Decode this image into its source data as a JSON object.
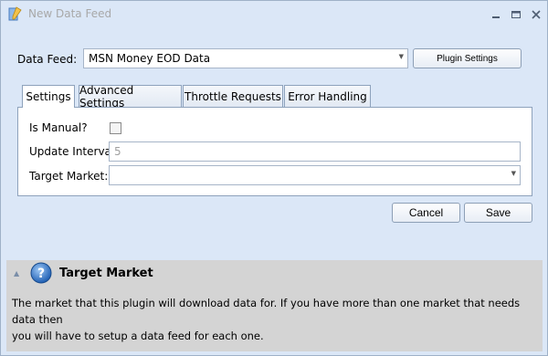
{
  "window": {
    "title": "New Data Feed",
    "icons": {
      "app": "app-feed-icon",
      "minimize": "minimize-icon",
      "maximize": "maximize-icon",
      "close": "close-icon"
    }
  },
  "form": {
    "data_feed_label": "Data Feed:",
    "data_feed_value": "MSN Money EOD Data",
    "plugin_settings_label": "Plugin Settings",
    "tabs": [
      {
        "label": "Settings",
        "active": true
      },
      {
        "label": "Advanced Settings",
        "active": false
      },
      {
        "label": "Throttle Requests",
        "active": false
      },
      {
        "label": "Error Handling",
        "active": false
      }
    ],
    "settings": {
      "is_manual_label": "Is Manual?",
      "is_manual_checked": false,
      "update_interval_label": "Update Interval:",
      "update_interval_value": "5",
      "target_market_label": "Target Market:",
      "target_market_value": ""
    },
    "cancel_label": "Cancel",
    "save_label": "Save"
  },
  "help": {
    "icon": "question-icon",
    "title": "Target Market",
    "text_line1": "The market that this plugin will download data for. If you have more than one market that needs data then",
    "text_line2": "you will have to setup a data feed for each one."
  },
  "colors": {
    "window_bg": "#dbe7f7",
    "panel_bg": "#ffffff",
    "help_bg": "#d4d4d4",
    "help_icon": "#2a74c8"
  }
}
